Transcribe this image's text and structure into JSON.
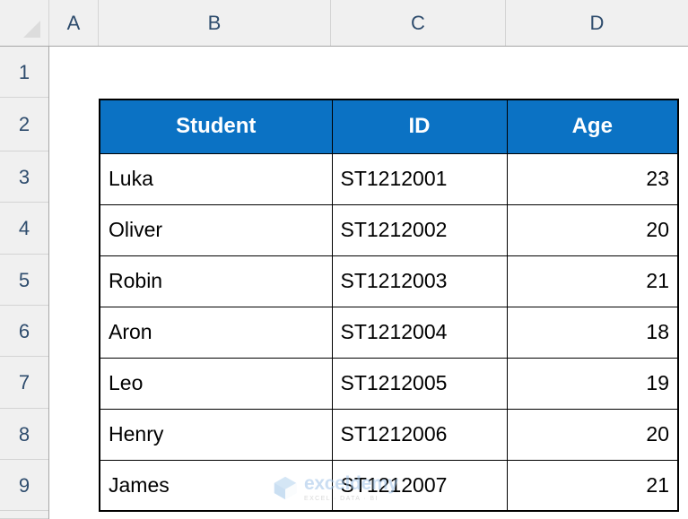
{
  "app": {
    "type": "spreadsheet",
    "select_all_label": ""
  },
  "grid": {
    "column_headers": [
      "A",
      "B",
      "C",
      "D"
    ],
    "row_headers": [
      "1",
      "2",
      "3",
      "4",
      "5",
      "6",
      "7",
      "8",
      "9"
    ]
  },
  "table": {
    "header_fill": "#0b72c4",
    "header_text_color": "#ffffff",
    "columns": [
      "Student",
      "ID",
      "Age"
    ],
    "rows": [
      {
        "student": "Luka",
        "id": "ST1212001",
        "age": "23"
      },
      {
        "student": "Oliver",
        "id": "ST1212002",
        "age": "20"
      },
      {
        "student": "Robin",
        "id": "ST1212003",
        "age": "21"
      },
      {
        "student": "Aron",
        "id": "ST1212004",
        "age": "18"
      },
      {
        "student": "Leo",
        "id": "ST1212005",
        "age": "19"
      },
      {
        "student": "Henry",
        "id": "ST1212006",
        "age": "20"
      },
      {
        "student": "James",
        "id": "ST1212007",
        "age": "21"
      }
    ]
  },
  "watermark": {
    "name": "exceldemy",
    "tagline": "EXCEL · DATA · BI"
  }
}
